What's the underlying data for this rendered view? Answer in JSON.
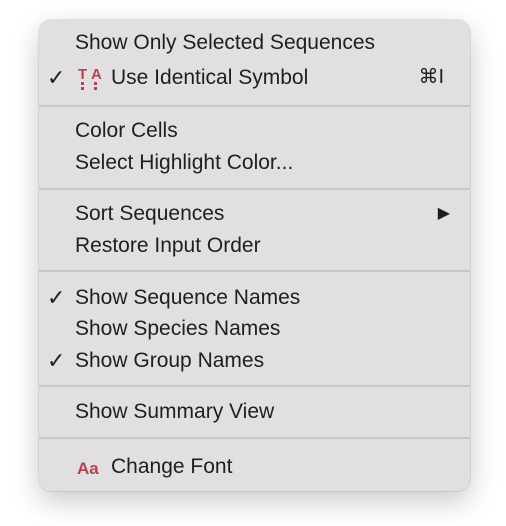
{
  "menu": {
    "show_only_selected": "Show Only Selected Sequences",
    "use_identical_symbol": "Use Identical Symbol",
    "use_identical_symbol_shortcut": "⌘I",
    "color_cells": "Color Cells",
    "select_highlight_color": "Select Highlight Color...",
    "sort_sequences": "Sort Sequences",
    "restore_input_order": "Restore Input Order",
    "show_sequence_names": "Show Sequence Names",
    "show_species_names": "Show Species Names",
    "show_group_names": "Show Group Names",
    "show_summary_view": "Show Summary View",
    "change_font": "Change Font",
    "checkmark": "✓",
    "submenu_arrow": "▶",
    "icons": {
      "identical_symbol": "identical-symbol-icon",
      "font": "font-icon"
    },
    "accent_color": "#b3444f"
  }
}
